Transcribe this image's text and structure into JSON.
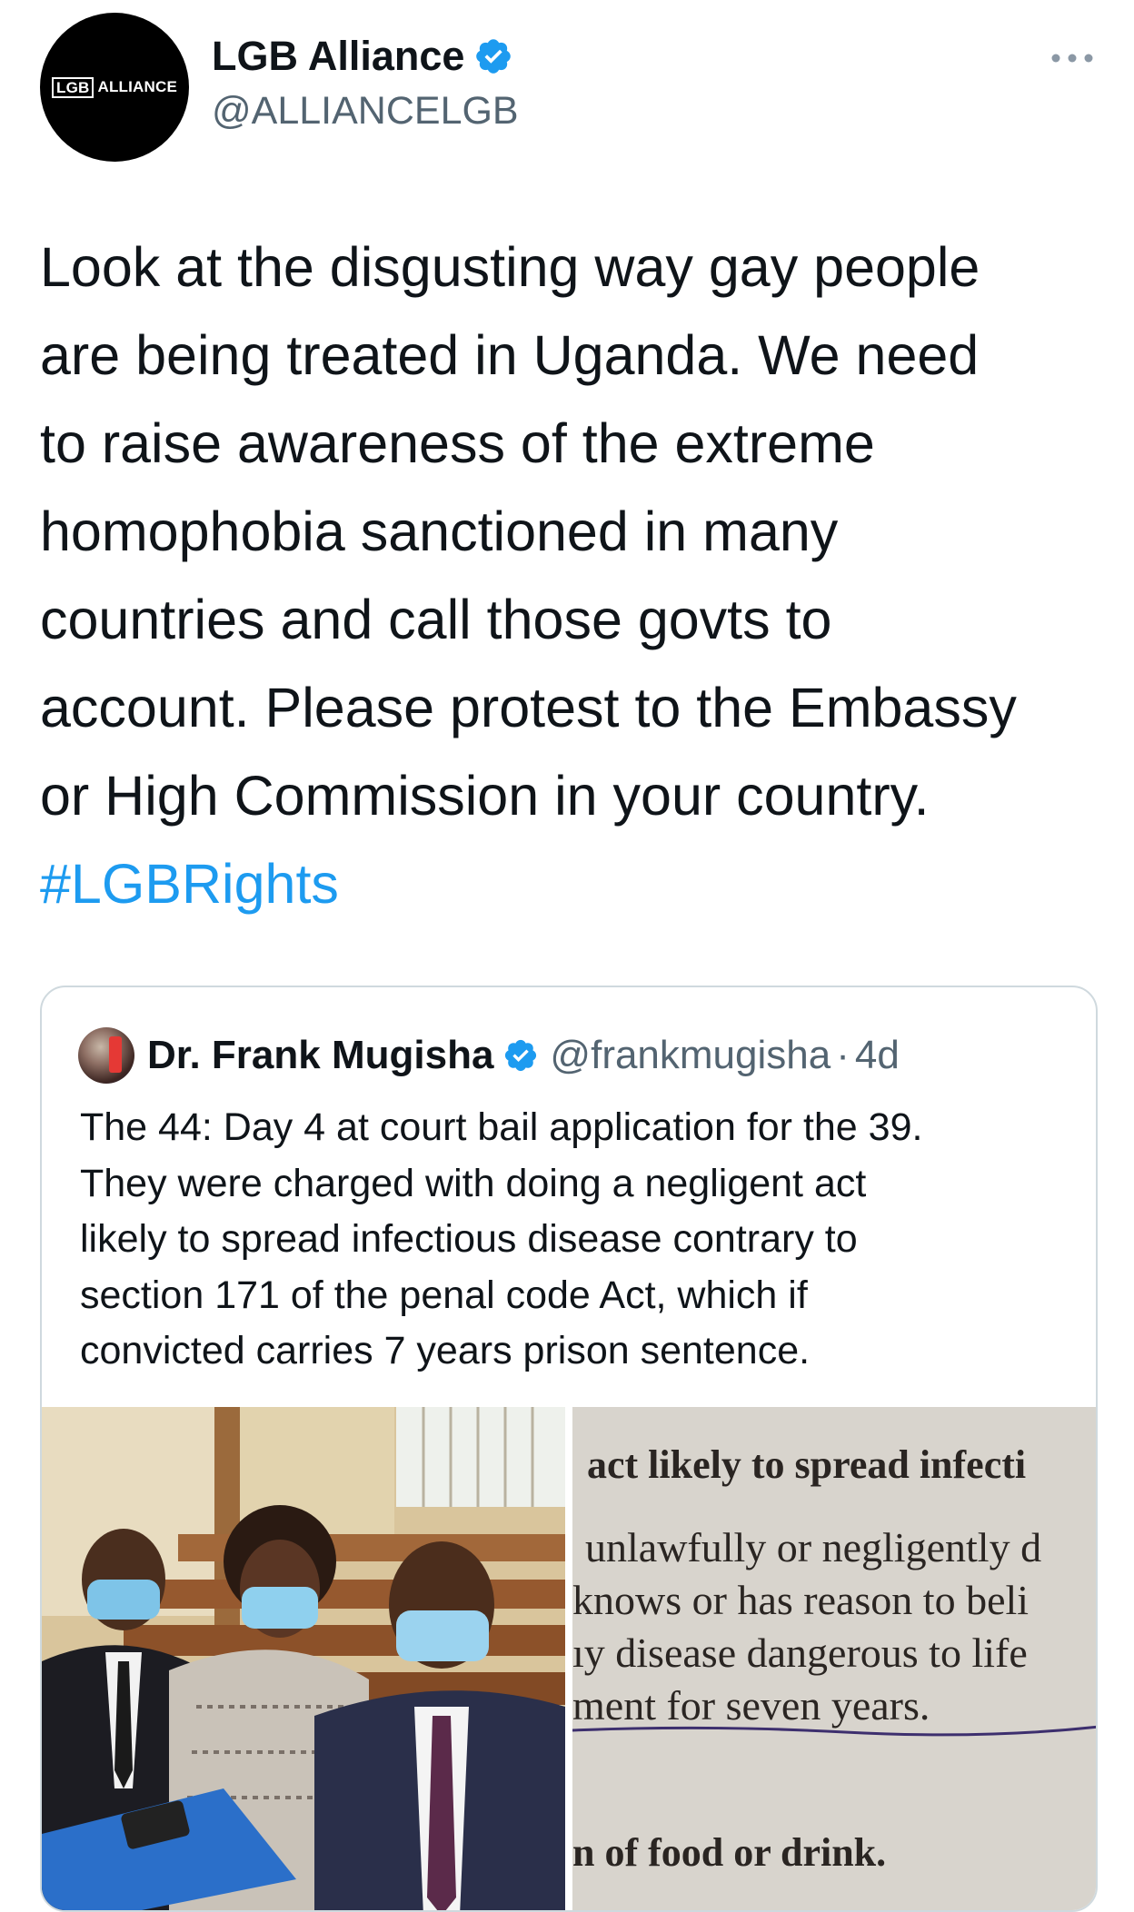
{
  "tweet": {
    "author": {
      "display_name": "LGB Alliance",
      "handle": "@ALLIANCELGB",
      "verified": true,
      "avatar_logo": {
        "boxed": "LGB",
        "text": "ALLIANCE"
      }
    },
    "more_icon": "more-horizontal-icon",
    "text_lines": [
      "Look at the disgusting way gay people",
      "are being treated in Uganda. We need",
      "to raise awareness of the extreme",
      "homophobia sanctioned in many",
      "countries and call those govts to",
      "account. Please protest to the Embassy",
      "or High Commission in your country."
    ],
    "hashtag": "#LGBRights"
  },
  "quote": {
    "author": {
      "display_name": "Dr. Frank Mugisha",
      "handle": "@frankmugisha",
      "separator": "·",
      "time": "4d",
      "verified": true
    },
    "text_lines": [
      "The 44: Day 4 at court bail application for the 39.",
      "They were charged with doing a negligent act",
      "likely to spread infectious disease contrary to",
      "section 171 of the penal code Act, which if",
      "convicted carries 7 years prison sentence."
    ],
    "media": [
      {
        "kind": "photo",
        "subject": "three people in face masks seated in a courtroom"
      },
      {
        "kind": "photo",
        "subject": "printed legal text excerpt",
        "lines": [
          "act likely to spread infecti",
          "unlawfully or negligently d",
          "knows or has reason to beli",
          "ıy disease dangerous to life",
          "ment for seven years.",
          "n of food or drink."
        ]
      }
    ]
  },
  "colors": {
    "text": "#0f1419",
    "secondary": "#536471",
    "link": "#1d9bf0",
    "verified": "#1d9bf0",
    "border": "#cfd9de"
  }
}
